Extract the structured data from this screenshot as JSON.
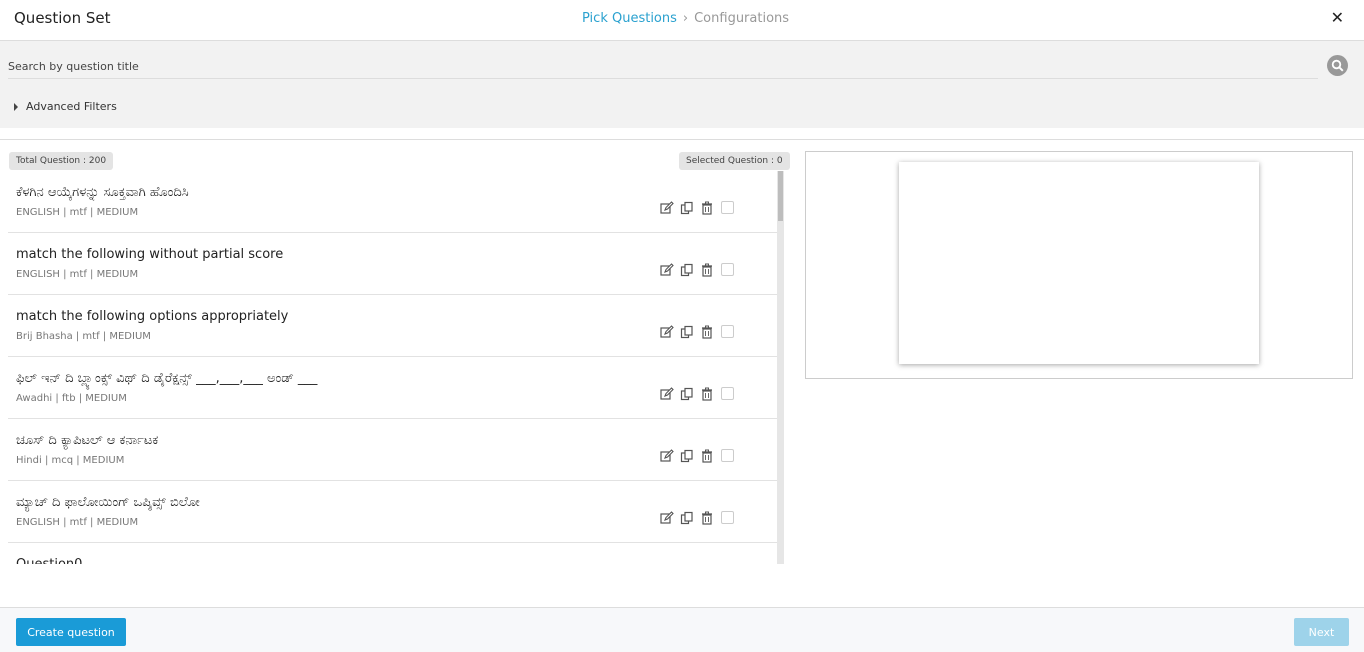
{
  "header": {
    "title": "Question Set",
    "steps": [
      "Pick Questions",
      "Configurations"
    ],
    "active_step": "Pick Questions",
    "close_icon": "close-icon"
  },
  "search": {
    "placeholder": "Search by question title",
    "value": "",
    "icon": "search-icon",
    "advanced_filters_label": "Advanced Filters"
  },
  "counts": {
    "total_label": "Total Question : 200",
    "selected_label": "Selected Question : 0"
  },
  "questions": [
    {
      "title": "ಕೆಳಗಿನ ಆಯ್ಕೆಗಳನ್ನು ಸೂಕ್ತವಾಗಿ ಹೊಂದಿಸಿ",
      "meta": "ENGLISH | mtf | MEDIUM"
    },
    {
      "title": "match the following without partial score",
      "meta": "ENGLISH | mtf | MEDIUM"
    },
    {
      "title": "match the following options appropriately",
      "meta": "Brij Bhasha | mtf | MEDIUM"
    },
    {
      "title": "ಫಿಲ್ ಇನ್ ದಿ ಬ್ಲ್ಯಾಂಕ್ಸ್ ವಿಥ್ ದಿ ಡೈರೆಕ್ಷನ್ಸ್ ___,___,___ ಅಂಡ್ ___",
      "meta": "Awadhi | ftb | MEDIUM"
    },
    {
      "title": "ಚೂಸ್ ದಿ ಕ್ಯಾಪಿಟಲ್ ಆ ಕರ್ನಾಟಕ",
      "meta": "Hindi | mcq | MEDIUM"
    },
    {
      "title": "ಮ್ಯಾಚ್ ದಿ ಫಾಲೋಯಿಂಗ್ ಒಪ್ಶಿವ್ಸ್ ಬಿಲೋ",
      "meta": "ENGLISH | mtf | MEDIUM"
    },
    {
      "title": "Question0",
      "meta": ""
    }
  ],
  "row_icons": [
    "edit-icon",
    "copy-icon",
    "delete-icon"
  ],
  "footer": {
    "create_label": "Create question",
    "next_label": "Next"
  },
  "colors": {
    "accent": "#1a9bd7",
    "step_active": "#2aa1cf",
    "next_disabled": "#9ed3ea"
  }
}
